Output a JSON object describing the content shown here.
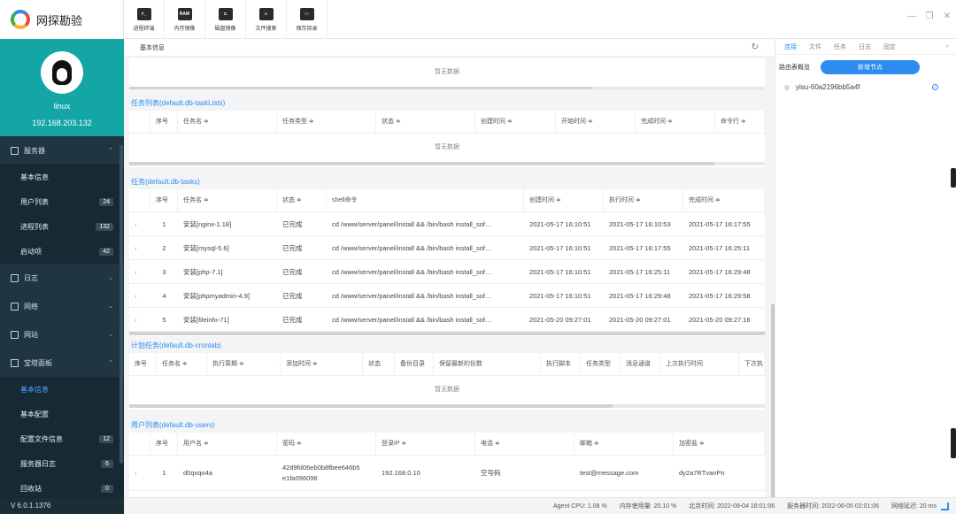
{
  "app": {
    "title": "网探勘验"
  },
  "toolbar": {
    "items": [
      {
        "label": "进程终端",
        "icon": "terminal-icon",
        "glyph": ">_"
      },
      {
        "label": "内存镜像",
        "icon": "ram-icon",
        "glyph": "RAM"
      },
      {
        "label": "磁盘镜像",
        "icon": "disk-icon",
        "glyph": "◘"
      },
      {
        "label": "文件搜索",
        "icon": "file-search-icon",
        "glyph": "⌕"
      },
      {
        "label": "保存目录",
        "icon": "folder-icon",
        "glyph": "▭"
      }
    ]
  },
  "user": {
    "name": "linux",
    "ip": "192.168.203.132"
  },
  "sidebar": {
    "groups": [
      {
        "label": "服务器",
        "icon": "server-icon",
        "chevron": "⌃"
      },
      {
        "label": "日志",
        "icon": "log-icon",
        "chevron": "⌄"
      },
      {
        "label": "网络",
        "icon": "network-icon",
        "chevron": "⌄"
      },
      {
        "label": "网站",
        "icon": "website-icon",
        "chevron": "⌄"
      },
      {
        "label": "宝塔面板",
        "icon": "panel-icon",
        "chevron": "⌃"
      }
    ],
    "server_items": [
      {
        "label": "基本信息",
        "badge": ""
      },
      {
        "label": "用户列表",
        "badge": "24"
      },
      {
        "label": "进程列表",
        "badge": "132"
      },
      {
        "label": "启动项",
        "badge": "42"
      }
    ],
    "panel_items": [
      {
        "label": "基本信息",
        "badge": ""
      },
      {
        "label": "基本配置",
        "badge": ""
      },
      {
        "label": "配置文件信息",
        "badge": "12"
      },
      {
        "label": "服务器日志",
        "badge": "6"
      },
      {
        "label": "回收站",
        "badge": "0"
      }
    ],
    "version": "V 6.0.1.1376"
  },
  "main": {
    "header": "基本信息",
    "empty_text": "暂无数据",
    "task_lists": {
      "title": "任务列表(default.db-taskLists)",
      "columns": [
        "序号",
        "任务名 ≑",
        "任务类型 ≑",
        "状态 ≑",
        "创建时间 ≑",
        "开始时间 ≑",
        "完成时间 ≑",
        "命令行 ≑"
      ]
    },
    "tasks": {
      "title": "任务(default.db-tasks)",
      "columns": [
        "序号",
        "任务名 ≑",
        "状态 ≑",
        "shell命令",
        "创建时间 ≑",
        "执行时间 ≑",
        "完成时间 ≑"
      ],
      "rows": [
        {
          "n": "1",
          "name": "安装[nginx-1.18]",
          "status": "已完成",
          "shell": "cd /www/server/panel/install && /bin/bash install_sof…",
          "created": "2021-05-17 16:10:51",
          "exec": "2021-05-17 16:10:53",
          "done": "2021-05-17 16:17:55"
        },
        {
          "n": "2",
          "name": "安装[mysql-5.6]",
          "status": "已完成",
          "shell": "cd /www/server/panel/install && /bin/bash install_sof…",
          "created": "2021-05-17 16:10:51",
          "exec": "2021-05-17 16:17:55",
          "done": "2021-05-17 16:25:11"
        },
        {
          "n": "3",
          "name": "安装[php-7.1]",
          "status": "已完成",
          "shell": "cd /www/server/panel/install && /bin/bash install_sof…",
          "created": "2021-05-17 16:10:51",
          "exec": "2021-05-17 16:25:11",
          "done": "2021-05-17 16:29:48"
        },
        {
          "n": "4",
          "name": "安装[phpmyadmin-4.9]",
          "status": "已完成",
          "shell": "cd /www/server/panel/install && /bin/bash install_sof…",
          "created": "2021-05-17 16:10:51",
          "exec": "2021-05-17 16:29:48",
          "done": "2021-05-17 16:29:58"
        },
        {
          "n": "5",
          "name": "安装[fileinfo-71]",
          "status": "已完成",
          "shell": "cd /www/server/panel/install && /bin/bash install_sof…",
          "created": "2021-05-20 09:27:01",
          "exec": "2021-05-20 09:27:01",
          "done": "2021-05-20 09:27:16"
        }
      ]
    },
    "crontab": {
      "title": "计划任务(default.db-crontab)",
      "columns": [
        "序号",
        "任务名 ≑",
        "执行周期 ≑",
        "添加时间 ≑",
        "状态",
        "备份目录",
        "保留最新的份数",
        "执行脚本",
        "任务类型",
        "消息通道",
        "上次执行时间",
        "下次执"
      ]
    },
    "users": {
      "title": "用户列表(default.db-users)",
      "columns": [
        "序号",
        "用户名 ≑",
        "密码 ≑",
        "登录IP ≑",
        "电话 ≑",
        "邮箱 ≑",
        "加密盐 ≑"
      ],
      "rows": [
        {
          "n": "1",
          "name": "d0qxqo4a",
          "pwd1": "42d9fd06eb0b8fbee646b5",
          "pwd2": "e1fa096096",
          "ip": "192.168.0.10",
          "phone": "空号码",
          "email": "test@message.com",
          "salt": "dy2a7RTvanPn"
        }
      ]
    }
  },
  "right": {
    "tabs": [
      "连接",
      "文件",
      "任务",
      "日志",
      "固定"
    ],
    "more": "»",
    "route_label": "路由表概览",
    "new_node": "新增节点",
    "node": "yisu-60a2196bb5a4f"
  },
  "status": {
    "cpu": "Agent CPU: 1.08 %",
    "mem": "内存使用量: 20.10 %",
    "bj": "北京时间: 2022-08-04 18:01:06",
    "srv": "服务器时间: 2022-08-05 02:01:06",
    "net": "网络延迟: 20 ms"
  },
  "window": {
    "min": "—",
    "max": "❐",
    "close": "✕"
  }
}
